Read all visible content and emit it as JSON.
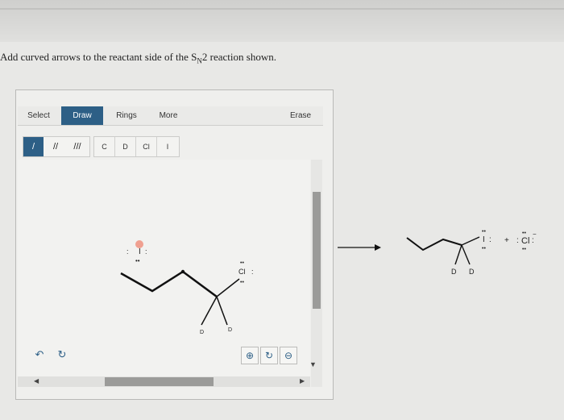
{
  "prompt": {
    "text_before": "Add curved arrows to the reactant side of the S",
    "subscript": "N",
    "text_after": "2 reaction shown."
  },
  "toolbar": {
    "select": "Select",
    "draw": "Draw",
    "rings": "Rings",
    "more": "More",
    "erase": "Erase"
  },
  "bonds": {
    "single": "/",
    "double": "//",
    "triple": "///"
  },
  "elements": [
    "C",
    "D",
    "Cl",
    "I"
  ],
  "canvas": {
    "iodide_label": "I",
    "chloride_label": "Cl",
    "deuterium_left": "D",
    "deuterium_right": "D"
  },
  "product": {
    "iodine": "I",
    "plus": "+",
    "chloride": "Cl",
    "deuterium_left": "D",
    "deuterium_right": "D"
  },
  "colors": {
    "accent": "#2d5f86",
    "charge_bubble": "#f0a090"
  },
  "icons": {
    "undo": "undo-icon",
    "redo": "redo-icon",
    "zoom_in": "zoom-in-icon",
    "zoom_reset": "zoom-reset-icon",
    "zoom_out": "zoom-out-icon"
  }
}
